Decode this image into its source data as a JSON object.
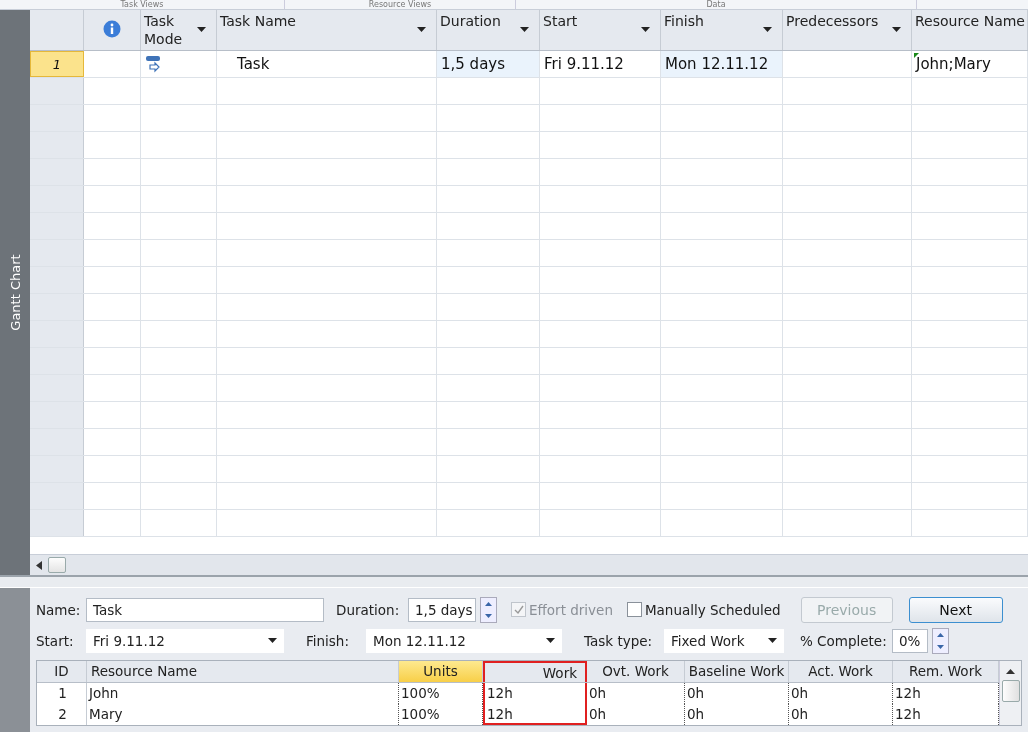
{
  "ribbon_groups": [
    "Task Views",
    "Resource Views",
    "Data"
  ],
  "view_bar": {
    "label": "Gantt Chart"
  },
  "table": {
    "columns": [
      {
        "kind": "info",
        "dropdown": false
      },
      {
        "label": "Task Mode",
        "kind": "text",
        "dropdown": true
      },
      {
        "label": "Task Name",
        "kind": "text",
        "dropdown": true
      },
      {
        "label": "Duration",
        "kind": "text",
        "dropdown": true
      },
      {
        "label": "Start",
        "kind": "text",
        "dropdown": true
      },
      {
        "label": "Finish",
        "kind": "text",
        "dropdown": true
      },
      {
        "label": "Predecessors",
        "kind": "text",
        "dropdown": true
      },
      {
        "label": "Resource Name",
        "kind": "text",
        "dropdown": false
      }
    ],
    "rows": [
      {
        "id": "1",
        "selected": true,
        "task_name": "Task",
        "duration": "1,5 days",
        "start": "Fri 9.11.12",
        "finish": "Mon 12.11.12",
        "resource_names": "John;Mary"
      }
    ]
  },
  "form": {
    "name_label": "Name:",
    "name": "Task",
    "duration_label": "Duration:",
    "duration": "1,5 days",
    "effort_driven": {
      "label": "Effort driven",
      "checked": true,
      "disabled": true
    },
    "manually_scheduled": {
      "label": "Manually Scheduled",
      "checked": false,
      "disabled": false
    },
    "previous_button": {
      "label": "Previous",
      "disabled": true
    },
    "next_button": {
      "label": "Next",
      "disabled": false
    },
    "start_label": "Start:",
    "start": "Fri 9.11.12",
    "finish_label": "Finish:",
    "finish": "Mon 12.11.12",
    "task_type_label": "Task type:",
    "task_type": "Fixed Work",
    "complete_label": "% Complete:",
    "complete": "0%"
  },
  "assignments": {
    "columns": [
      {
        "label": "ID",
        "highlighted": false,
        "boxed": false
      },
      {
        "label": "Resource Name",
        "highlighted": false,
        "boxed": false
      },
      {
        "label": "Units",
        "highlighted": true,
        "boxed": false
      },
      {
        "label": "Work",
        "highlighted": false,
        "boxed": true
      },
      {
        "label": "Ovt. Work",
        "highlighted": false,
        "boxed": false
      },
      {
        "label": "Baseline Work",
        "highlighted": false,
        "boxed": false
      },
      {
        "label": "Act. Work",
        "highlighted": false,
        "boxed": false
      },
      {
        "label": "Rem. Work",
        "highlighted": false,
        "boxed": false
      }
    ],
    "rows": [
      [
        "1",
        "John",
        "100%",
        "12h",
        "0h",
        "0h",
        "0h",
        "12h"
      ],
      [
        "2",
        "Mary",
        "100%",
        "12h",
        "0h",
        "0h",
        "0h",
        "12h"
      ]
    ]
  }
}
